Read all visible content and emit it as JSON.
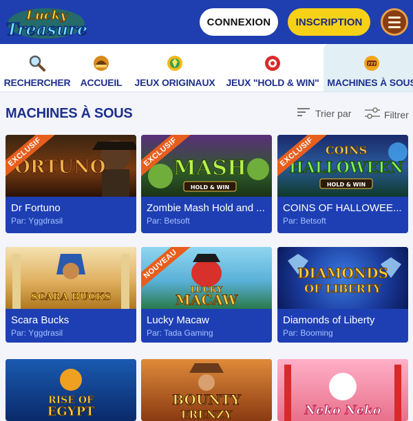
{
  "header": {
    "logo_line1": "Lucky",
    "logo_line2": "Treasure",
    "login_label": "CONNEXION",
    "signup_label": "INSCRIPTION"
  },
  "categories": [
    {
      "label": "RECHERCHER",
      "icon": "search-icon"
    },
    {
      "label": "ACCUEIL",
      "icon": "home-icon"
    },
    {
      "label": "JEUX ORIGINAUX",
      "icon": "originals-icon"
    },
    {
      "label": "JEUX \"HOLD & WIN\"",
      "icon": "hold-win-icon"
    },
    {
      "label": "MACHINES À SOUS",
      "icon": "slots-icon",
      "active": true
    }
  ],
  "section": {
    "title": "MACHINES À SOUS",
    "sort_label": "Trier par",
    "filter_label": "Filtrer"
  },
  "games": [
    {
      "name": "Dr Fortuno",
      "provider": "Par: Yggdrasil",
      "badge": "EXCLUSIF",
      "art_text": "FORTUNO"
    },
    {
      "name": "Zombie Mash Hold and ...",
      "provider": "Par: Betsoft",
      "badge": "EXCLUSIF",
      "art_text": "MASH",
      "art_sub": "HOLD & WIN"
    },
    {
      "name": "COINS OF HALLOWEE...",
      "provider": "Par: Betsoft",
      "badge": "EXCLUSIF",
      "art_text": "HALLOWEEN",
      "art_top": "COINS",
      "art_sub": "HOLD & WIN"
    },
    {
      "name": "Scara Bucks",
      "provider": "Par: Yggdrasil",
      "badge": "",
      "art_text": "SCARA BUCKS"
    },
    {
      "name": "Lucky Macaw",
      "provider": "Par: Tada Gaming",
      "badge": "NOUVEAU",
      "art_text": "MACAW",
      "art_top": "LUCKY"
    },
    {
      "name": "Diamonds of Liberty",
      "provider": "Par: Booming",
      "badge": "",
      "art_text": "DIAMONDS",
      "art_sub": "OF LIBERTY"
    },
    {
      "name": "",
      "provider": "",
      "badge": "",
      "art_text": "EGYPT",
      "art_top": "RISE OF"
    },
    {
      "name": "",
      "provider": "",
      "badge": "",
      "art_text": "BOUNTY",
      "art_sub": "FRENZY"
    },
    {
      "name": "",
      "provider": "",
      "badge": "",
      "art_text": "Neko Neko"
    }
  ],
  "colors": {
    "header_bg": "#1f3fb0",
    "accent_yellow": "#f7d117",
    "card_bg": "#1e3fb4",
    "title_blue": "#1d2f8c",
    "badge_orange": "#e85e1d"
  }
}
